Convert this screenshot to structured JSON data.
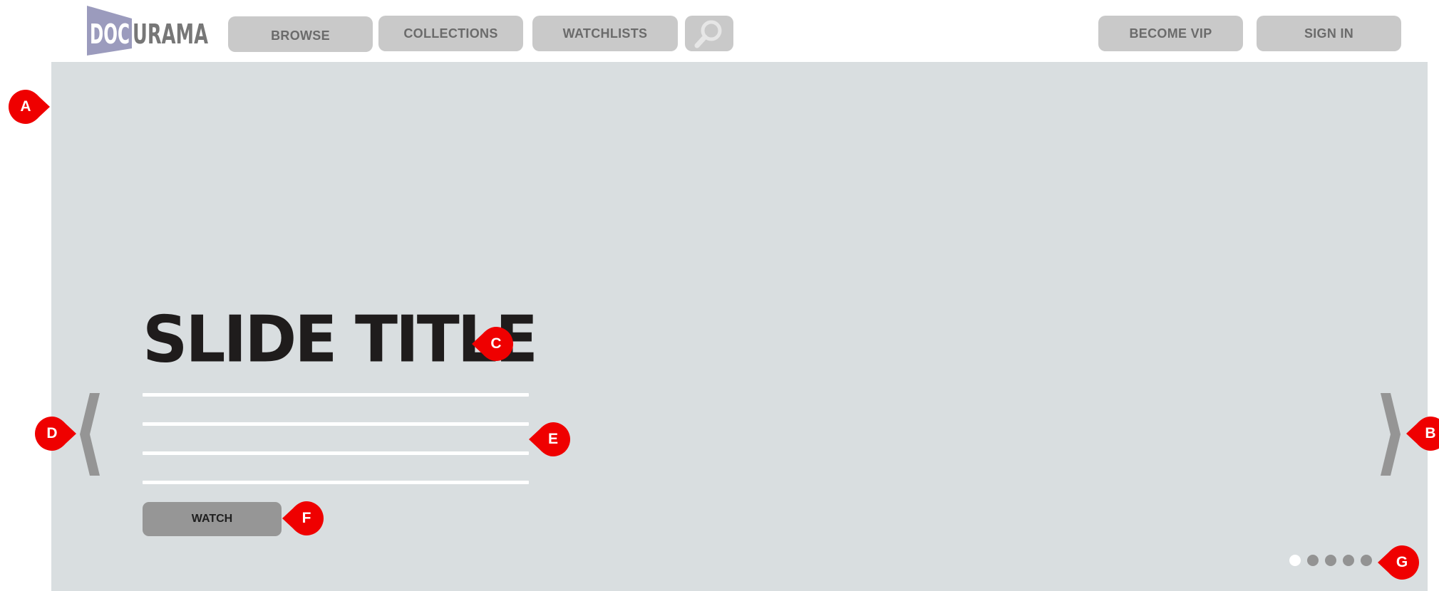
{
  "header": {
    "logo": {
      "part1": "DOC",
      "part2": "URAMA"
    },
    "nav": [
      {
        "label": "BROWSE"
      },
      {
        "label": "COLLECTIONS"
      },
      {
        "label": "WATCHLISTS"
      }
    ],
    "actions": [
      {
        "label": "BECOME VIP"
      },
      {
        "label": "SIGN IN"
      }
    ],
    "search_icon": "search-icon"
  },
  "slider": {
    "title": "SLIDE TITLE",
    "watch_label": "WATCH",
    "prev_icon": "chevron-left-icon",
    "next_icon": "chevron-right-icon",
    "dots": {
      "count": 5,
      "active_index": 0
    }
  },
  "annotations": {
    "a": "A",
    "b": "B",
    "c": "C",
    "d": "D",
    "e": "E",
    "f": "F",
    "g": "G"
  },
  "colors": {
    "hero_bg": "#d9dee0",
    "button_bg": "#c9c9c9",
    "marker": "#ef0000",
    "logo_box": "#9b9bbd",
    "logo_text": "#777777"
  }
}
